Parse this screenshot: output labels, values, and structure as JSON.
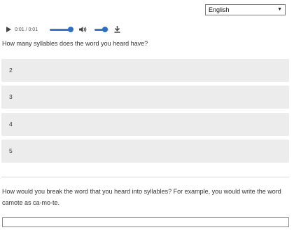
{
  "language_select": {
    "value": "English"
  },
  "audio": {
    "time": "0:01 / 0:01",
    "seek_progress": 1.0,
    "volume_level": 0.75
  },
  "question1": {
    "text": "How many syllables does the word you heard have?",
    "options": [
      "2",
      "3",
      "4",
      "5"
    ]
  },
  "question2": {
    "text": "How would you break the word that you heard into syllables? For example, you would write the word camote as ca-mo-te.",
    "answer_value": ""
  }
}
